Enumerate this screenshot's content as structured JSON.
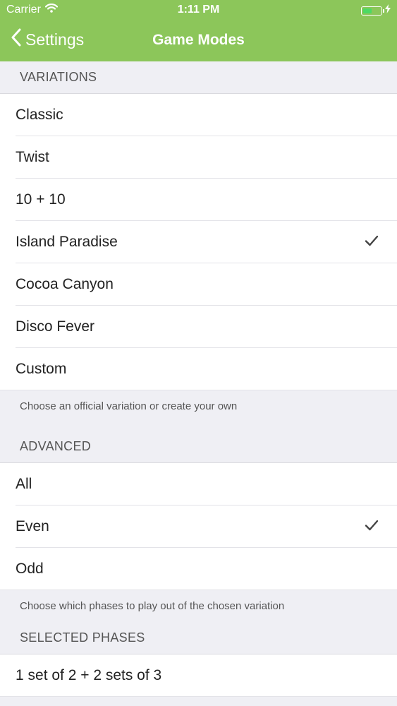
{
  "status_bar": {
    "carrier": "Carrier",
    "time": "1:11 PM"
  },
  "nav": {
    "back_label": "Settings",
    "title": "Game Modes"
  },
  "variations": {
    "header": "VARIATIONS",
    "items": [
      {
        "label": "Classic"
      },
      {
        "label": "Twist"
      },
      {
        "label": "10 + 10"
      },
      {
        "label": "Island Paradise",
        "checked": true
      },
      {
        "label": "Cocoa Canyon"
      },
      {
        "label": "Disco Fever"
      },
      {
        "label": "Custom"
      }
    ],
    "footer": "Choose an official variation or create your own"
  },
  "advanced": {
    "header": "ADVANCED",
    "items": [
      {
        "label": "All"
      },
      {
        "label": "Even",
        "checked": true
      },
      {
        "label": "Odd"
      }
    ],
    "footer": "Choose which phases to play out of the chosen variation"
  },
  "selected_phases": {
    "header": "SELECTED PHASES",
    "items": [
      {
        "label": "1 set of 2 + 2 sets of 3"
      }
    ]
  },
  "colors": {
    "nav_background": "#8cc65a",
    "battery_fill": "#4cd964"
  },
  "icons": [
    "wifi-icon",
    "battery-icon",
    "charging-bolt-icon",
    "back-chevron-icon",
    "checkmark-icon"
  ]
}
